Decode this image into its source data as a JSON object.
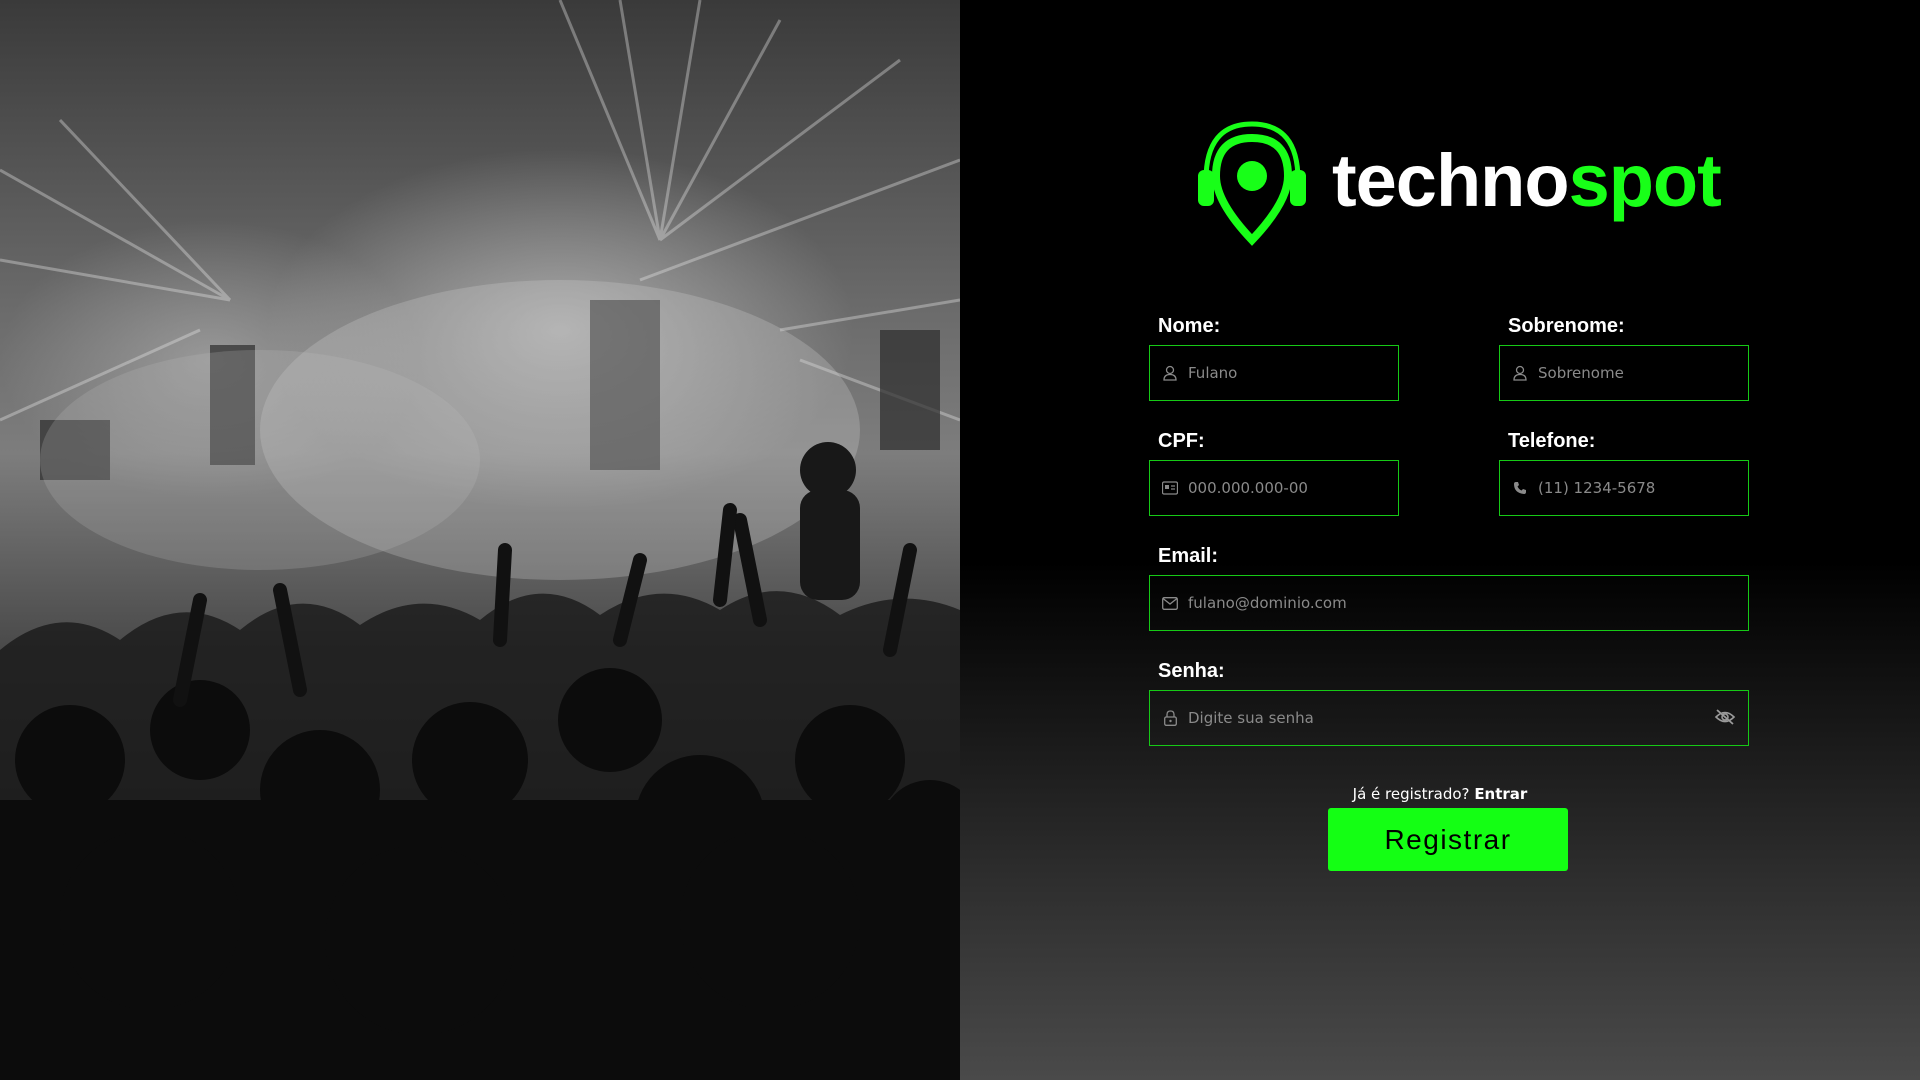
{
  "brand": {
    "name_part1": "techno",
    "name_part2": "spot",
    "accent_color": "#14ff14"
  },
  "form": {
    "nome": {
      "label": "Nome:",
      "placeholder": "Fulano",
      "icon": "user-icon"
    },
    "sobrenome": {
      "label": "Sobrenome:",
      "placeholder": "Sobrenome",
      "icon": "user-icon"
    },
    "cpf": {
      "label": "CPF:",
      "placeholder": "000.000.000-00",
      "icon": "id-card-icon"
    },
    "telefone": {
      "label": "Telefone:",
      "placeholder": "(11) 1234-5678",
      "icon": "phone-icon"
    },
    "email": {
      "label": "Email:",
      "placeholder": "fulano@dominio.com",
      "icon": "envelope-icon"
    },
    "senha": {
      "label": "Senha:",
      "placeholder": "Digite sua senha",
      "icon": "lock-icon",
      "toggle_icon": "eye-slash-icon"
    }
  },
  "login_prompt": {
    "text": "Já é registrado?",
    "link": "Entrar"
  },
  "submit": {
    "label": "Registrar"
  }
}
